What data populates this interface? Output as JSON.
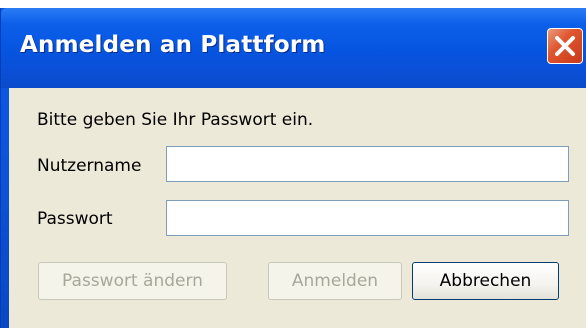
{
  "window": {
    "title": "Anmelden an Plattform",
    "close_icon": "close-icon"
  },
  "form": {
    "prompt": "Bitte geben Sie Ihr Passwort ein.",
    "username_label": "Nutzername",
    "username_value": "",
    "password_label": "Passwort",
    "password_value": ""
  },
  "buttons": {
    "change_password": "Passwort ändern",
    "login": "Anmelden",
    "cancel": "Abbrechen"
  },
  "colors": {
    "titlebar": "#0654e0",
    "close_button": "#e0552f",
    "dialog_background": "#ece9d8"
  }
}
